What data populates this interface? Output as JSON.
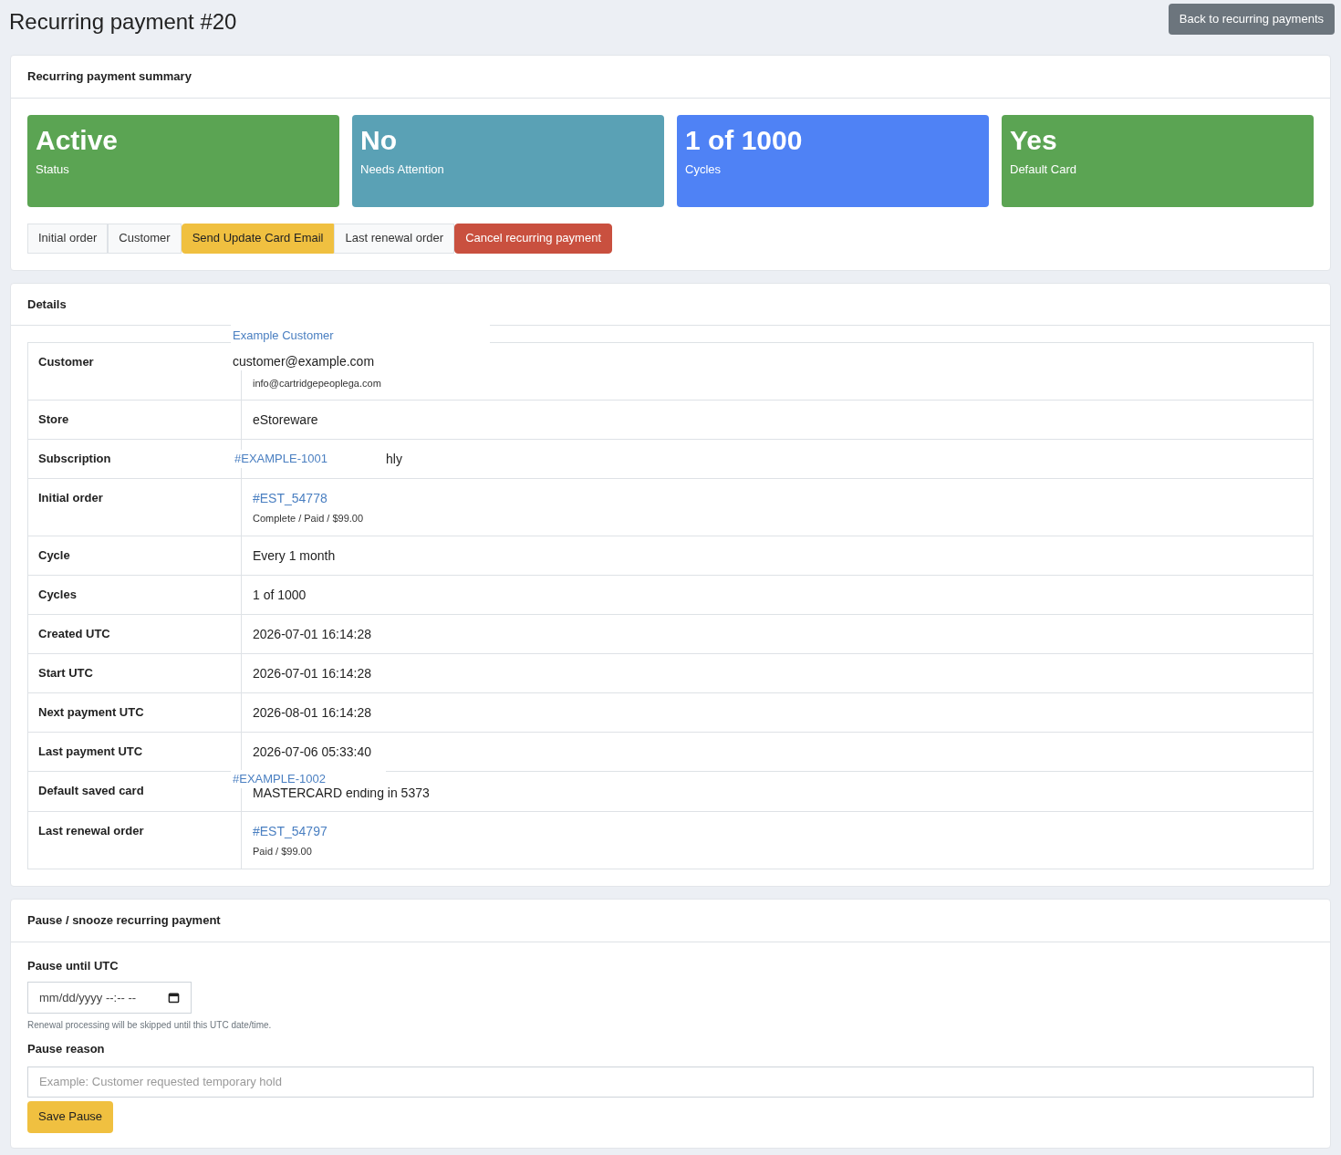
{
  "page": {
    "title": "Recurring payment #20",
    "back_button": "Back to recurring payments"
  },
  "summary": {
    "title": "Recurring payment summary",
    "tiles": [
      {
        "value": "Active",
        "label": "Status",
        "color": "#5ba453"
      },
      {
        "value": "No",
        "label": "Needs Attention",
        "color": "#5aa1b5"
      },
      {
        "value": "1 of 1000",
        "label": "Cycles",
        "color": "#4f82f5"
      },
      {
        "value": "Yes",
        "label": "Default Card",
        "color": "#5ba453"
      }
    ],
    "actions": [
      {
        "label": "Initial order",
        "kind": "default"
      },
      {
        "label": "Customer",
        "kind": "default"
      },
      {
        "label": "Send Update Card Email",
        "kind": "warning"
      },
      {
        "label": "Last renewal order",
        "kind": "default"
      },
      {
        "label": "Cancel recurring payment",
        "kind": "danger"
      }
    ]
  },
  "details": {
    "title": "Details",
    "rows": [
      {
        "label": "Customer",
        "kind": "customer",
        "overlay": [
          {
            "kind": "link",
            "text": "Example Customer"
          },
          {
            "kind": "text",
            "text": "customer@example.com"
          }
        ],
        "lines": [
          {
            "kind": "small",
            "text": "info@cartridgepeoplega.com"
          }
        ]
      },
      {
        "label": "Store",
        "kind": "plain",
        "lines": [
          {
            "kind": "text",
            "text": "eStoreware"
          }
        ]
      },
      {
        "label": "Subscription",
        "kind": "inline",
        "overlay": [
          {
            "kind": "link",
            "text": "#EXAMPLE-1001"
          }
        ],
        "lines": [
          {
            "kind": "text",
            "text": "hly"
          }
        ]
      },
      {
        "label": "Initial order",
        "kind": "plain",
        "lines": [
          {
            "kind": "link",
            "text": "#EST_54778"
          },
          {
            "kind": "small",
            "text": "Complete / Paid / $99.00"
          }
        ]
      },
      {
        "label": "Cycle",
        "kind": "plain",
        "lines": [
          {
            "kind": "text",
            "text": "Every 1 month"
          }
        ]
      },
      {
        "label": "Cycles",
        "kind": "plain",
        "lines": [
          {
            "kind": "text",
            "text": "1 of 1000"
          }
        ]
      },
      {
        "label": "Created UTC",
        "kind": "plain",
        "lines": [
          {
            "kind": "text",
            "text": "2026-07-01 16:14:28"
          }
        ]
      },
      {
        "label": "Start UTC",
        "kind": "plain",
        "lines": [
          {
            "kind": "text",
            "text": "2026-07-01 16:14:28"
          }
        ]
      },
      {
        "label": "Next payment UTC",
        "kind": "plain",
        "lines": [
          {
            "kind": "text",
            "text": "2026-08-01 16:14:28"
          }
        ]
      },
      {
        "label": "Last payment UTC",
        "kind": "plain",
        "lines": [
          {
            "kind": "text",
            "text": "2026-07-06 05:33:40"
          }
        ]
      },
      {
        "label": "Default saved card",
        "kind": "card",
        "overlay": [
          {
            "kind": "link",
            "text": "#EXAMPLE-1002"
          }
        ],
        "lines": [
          {
            "kind": "text",
            "text": "MASTERCARD ending in 5373"
          }
        ]
      },
      {
        "label": "Last renewal order",
        "kind": "plain",
        "lines": [
          {
            "kind": "link",
            "text": "#EST_54797"
          },
          {
            "kind": "small",
            "text": "Paid / $99.00"
          }
        ]
      }
    ]
  },
  "pause": {
    "title": "Pause / snooze recurring payment",
    "until_label": "Pause until UTC",
    "until_placeholder": "mm/dd/yyyy --:-- --",
    "help": "Renewal processing will be skipped until this UTC date/time.",
    "reason_label": "Pause reason",
    "reason_placeholder": "Example: Customer requested temporary hold",
    "save_button": "Save Pause"
  }
}
